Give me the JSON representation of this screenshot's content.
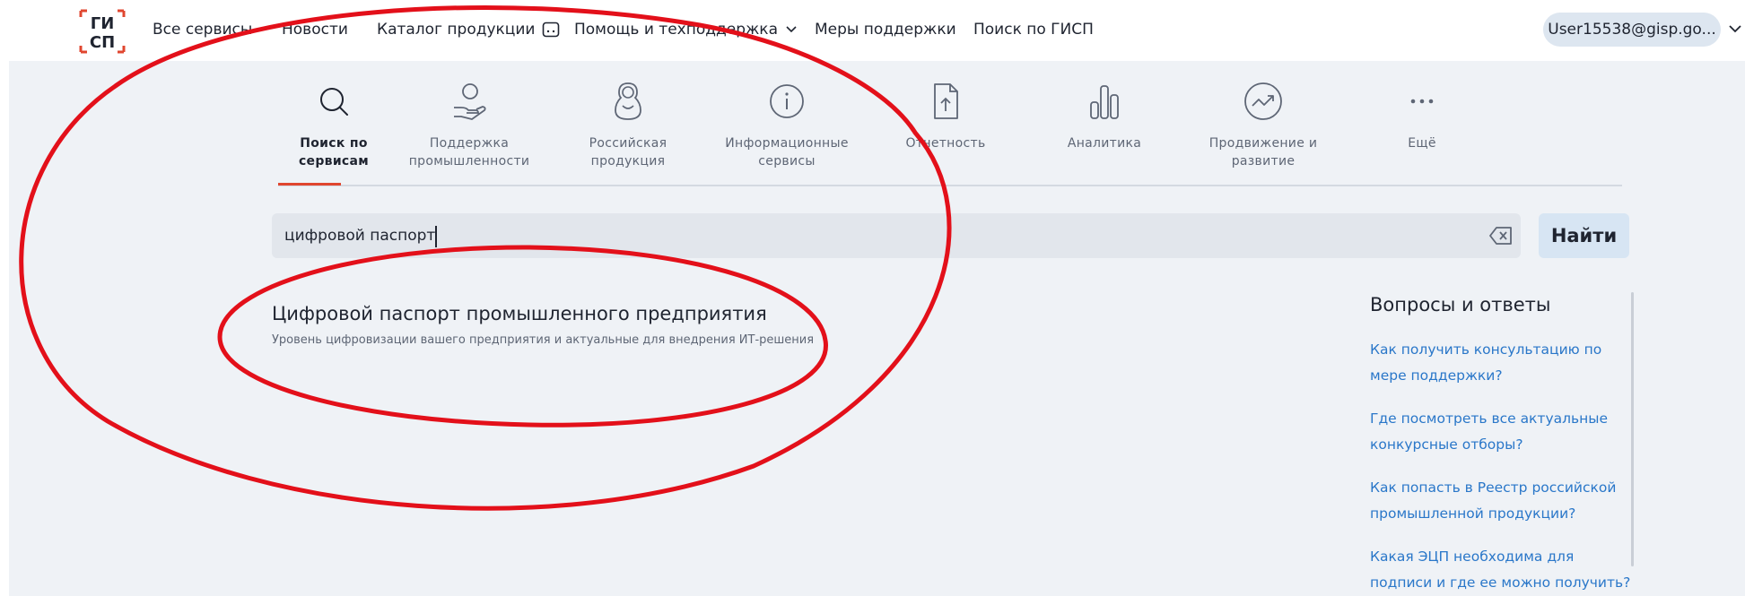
{
  "header": {
    "logo_text_top": "ГИ",
    "logo_text_bottom": "СП",
    "nav": [
      {
        "label": "Все сервисы"
      },
      {
        "label": "Новости"
      },
      {
        "label": "Каталог продукции"
      },
      {
        "label": "Помощь и техподдержка"
      },
      {
        "label": "Меры поддержки"
      },
      {
        "label": "Поиск по ГИСП"
      }
    ],
    "user": "User15538@gisp.go..."
  },
  "tabs": [
    {
      "label": "Поиск по сервисам",
      "icon": "search-icon",
      "active": true
    },
    {
      "label": "Поддержка промышленности",
      "icon": "support-hand-icon"
    },
    {
      "label": "Российская продукция",
      "icon": "matryoshka-icon"
    },
    {
      "label": "Информационные сервисы",
      "icon": "info-icon"
    },
    {
      "label": "Отчетность",
      "icon": "report-upload-icon"
    },
    {
      "label": "Аналитика",
      "icon": "bar-chart-icon"
    },
    {
      "label": "Продвижение и развитие",
      "icon": "trend-up-icon"
    },
    {
      "label": "Ещё",
      "icon": "more-dots-icon"
    }
  ],
  "search": {
    "value": "цифровой паспорт",
    "button": "Найти"
  },
  "result": {
    "title": "Цифровой паспорт промышленного предприятия",
    "description": "Уровень цифровизации вашего предприятия и актуальные для внедрения ИТ-решения"
  },
  "faq": {
    "title": "Вопросы и ответы",
    "items": [
      "Как получить консультацию по мере поддержки?",
      "Где посмотреть все актуальные конкурсные отборы?",
      "Как попасть в Реестр российской промышленной продукции?",
      "Какая ЭЦП необходима для подписи и где ее можно получить?"
    ]
  },
  "colors": {
    "accent": "#e0462f",
    "link": "#2a77c9",
    "annotation": "#e3101a"
  }
}
